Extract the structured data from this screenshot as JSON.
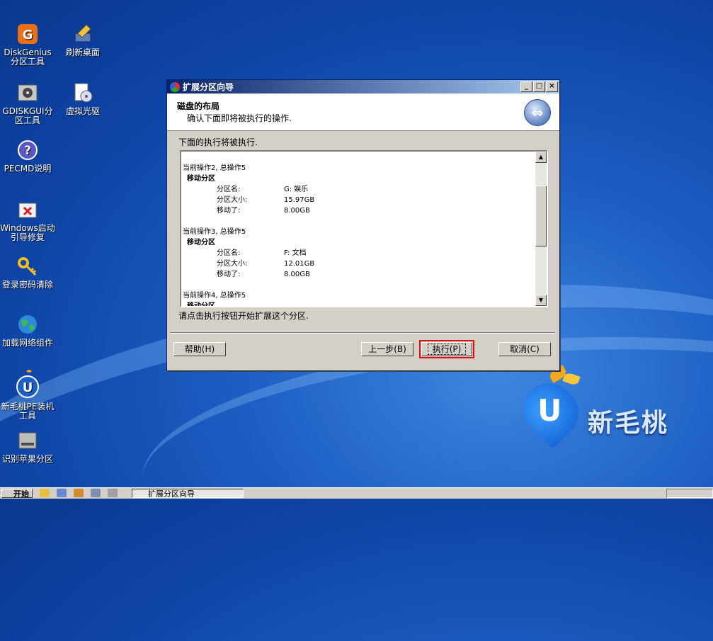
{
  "desktop": {
    "icons": [
      {
        "label": "DiskGenius分区工具",
        "icon": "diskgenius-icon"
      },
      {
        "label": "刷新桌面",
        "icon": "refresh-desktop-icon"
      },
      {
        "label": "GDISKGUI分区工具",
        "icon": "gdiskgui-icon"
      },
      {
        "label": "虚拟光驱",
        "icon": "virtual-drive-icon"
      },
      {
        "label": "PECMD说明",
        "icon": "help-icon"
      },
      {
        "label": "Windows启动引导修复",
        "icon": "boot-repair-icon"
      },
      {
        "label": "登录密码清除",
        "icon": "key-icon"
      },
      {
        "label": "加载网络组件",
        "icon": "network-globe-icon"
      },
      {
        "label": "新毛桃PE装机工具",
        "icon": "installer-icon"
      },
      {
        "label": "识别苹果分区",
        "icon": "mac-partition-icon"
      }
    ]
  },
  "dialog": {
    "title": "扩展分区向导",
    "header_title": "磁盘的布局",
    "header_subtitle": "确认下面即将被执行的操作.",
    "list_caption": "下面的执行将被执行.",
    "operations": [
      {
        "op": "当前操作2, 总操作5",
        "action": "移动分区",
        "rows": [
          [
            "分区名:",
            "G: 娱乐"
          ],
          [
            "分区大小:",
            "15.97GB"
          ],
          [
            "移动了:",
            "8.00GB"
          ]
        ]
      },
      {
        "op": "当前操作3, 总操作5",
        "action": "移动分区",
        "rows": [
          [
            "分区名:",
            "F: 文档"
          ],
          [
            "分区大小:",
            "12.01GB"
          ],
          [
            "移动了:",
            "8.00GB"
          ]
        ]
      },
      {
        "op": "当前操作4, 总操作5",
        "action": "移动分区",
        "rows": []
      }
    ],
    "footer_text": "请点击执行按钮开始扩展这个分区.",
    "buttons": {
      "help": "帮助(H)",
      "back": "上一步(B)",
      "execute": "执行(P)",
      "cancel": "取消(C)"
    },
    "window_controls": {
      "minimize": "_",
      "maximize": "□",
      "close": "×"
    }
  },
  "brand": {
    "text": "新毛桃",
    "logo_letter": "U"
  },
  "taskbar": {
    "start_label": "开始",
    "task_item": "扩展分区向导"
  }
}
